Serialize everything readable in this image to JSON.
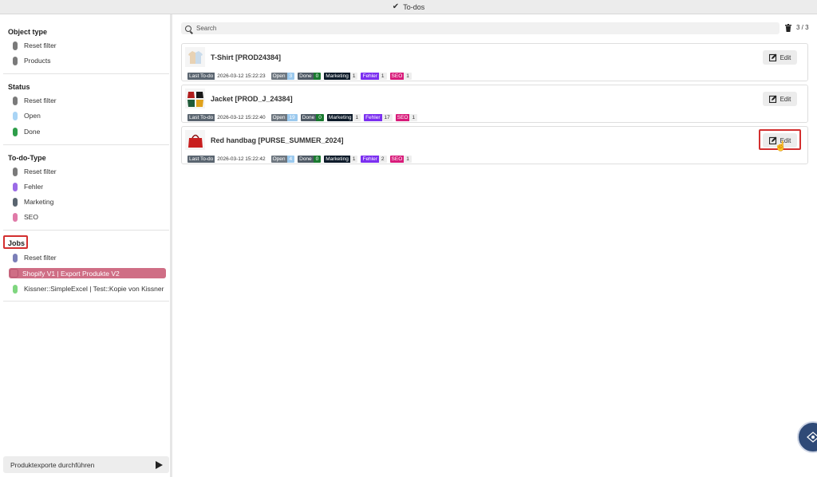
{
  "window": {
    "title": "To-dos"
  },
  "sidebar": {
    "sections": [
      {
        "title": "Object type",
        "items": [
          {
            "label": "Reset filter",
            "color": "#7a7a7a"
          },
          {
            "label": "Products",
            "color": "#7a7a7a"
          }
        ]
      },
      {
        "title": "Status",
        "items": [
          {
            "label": "Reset filter",
            "color": "#7a7a7a"
          },
          {
            "label": "Open",
            "color": "#a9d4f5"
          },
          {
            "label": "Done",
            "color": "#2e9e4a"
          }
        ]
      },
      {
        "title": "To-do-Type",
        "items": [
          {
            "label": "Reset filter",
            "color": "#7a7a7a"
          },
          {
            "label": "Fehler",
            "color": "#9b6ae6"
          },
          {
            "label": "Marketing",
            "color": "#5a6570"
          },
          {
            "label": "SEO",
            "color": "#e07aa8"
          }
        ]
      },
      {
        "title": "Jobs",
        "items": [
          {
            "label": "Reset filter",
            "color": "#7b7fb8"
          },
          {
            "label": "Shopify V1 | Export Produkte V2",
            "color": "#cf6e85",
            "selected": true
          },
          {
            "label": "Kissner::SimpleExcel | Test::Kopie von Kissner",
            "color": "#7fd67f"
          }
        ]
      }
    ],
    "run_button_label": "Produktexporte durchführen"
  },
  "toolbar": {
    "search_placeholder": "Search",
    "counter": "3 / 3"
  },
  "todos": [
    {
      "title": "T-Shirt [PROD24384]",
      "edit_label": "Edit",
      "last_todo_label": "Last To-do",
      "last_todo_value": "2026-03-12 15:22:23",
      "open": "3",
      "done": "0",
      "marketing": "1",
      "fehler": "1",
      "seo": "1",
      "thumb": "tshirt"
    },
    {
      "title": "Jacket [PROD_J_24384]",
      "edit_label": "Edit",
      "last_todo_label": "Last To-do",
      "last_todo_value": "2026-03-12 15:22:40",
      "open": "19",
      "done": "0",
      "marketing": "1",
      "fehler": "17",
      "seo": "1",
      "thumb": "jacket"
    },
    {
      "title": "Red handbag [PURSE_SUMMER_2024]",
      "edit_label": "Edit",
      "last_todo_label": "Last To-do",
      "last_todo_value": "2026-03-12 15:22:42",
      "open": "4",
      "done": "0",
      "marketing": "1",
      "fehler": "2",
      "seo": "1",
      "thumb": "handbag",
      "highlighted": true
    }
  ],
  "tag_labels": {
    "open": "Open",
    "done": "Done",
    "marketing": "Marketing",
    "fehler": "Fehler",
    "seo": "SEO"
  },
  "colors": {
    "open": "#6e7780",
    "done": "#4f5a66",
    "marketing": "#0d1b2a",
    "fehler": "#7b2ff0",
    "seo": "#d81b7a",
    "last_todo": "#5a6570",
    "accent_red": "#d32f2f"
  }
}
